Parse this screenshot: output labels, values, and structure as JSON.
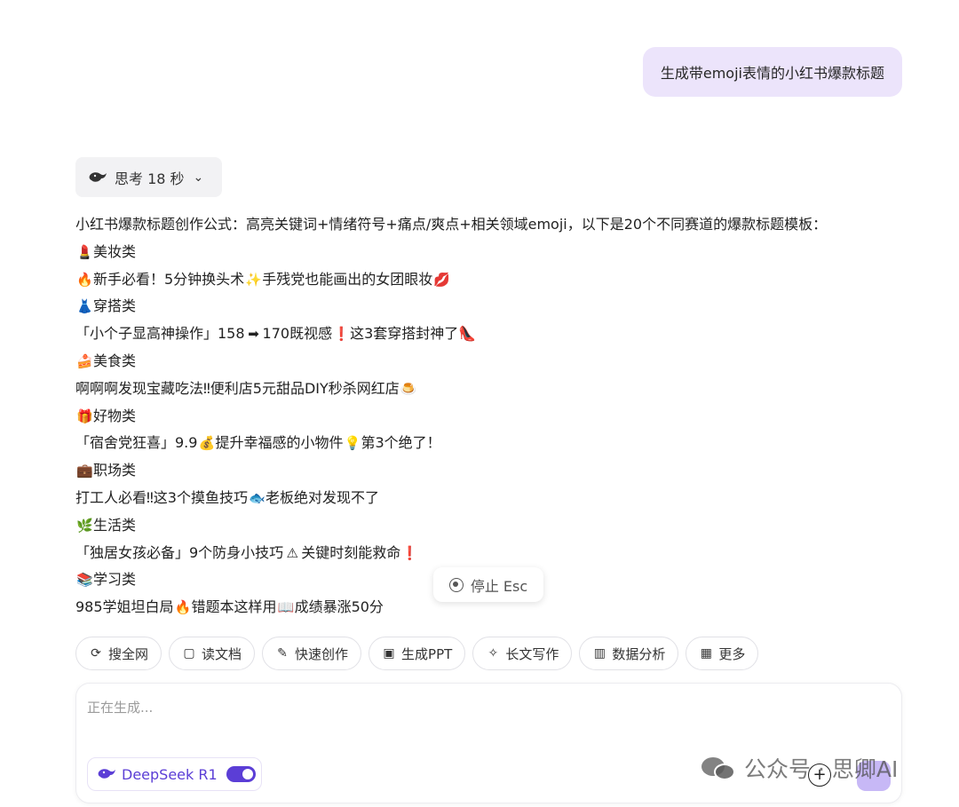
{
  "user_message": "生成带emoji表情的小红书爆款标题",
  "thinking": {
    "label": "思考 18 秒",
    "icon": "deepseek-whale-icon",
    "chevron": "⌄"
  },
  "answer": {
    "intro": "小红书爆款标题创作公式：高亮关键词+情绪符号+痛点/爽点+相关领域emoji，以下是20个不同赛道的爆款标题模板：",
    "sections": [
      {
        "cat_emoji": "💄",
        "category": "美妆类",
        "emoji1": "🔥",
        "part1": "新手必看！5分钟换头术",
        "emoji2": "✨",
        "part2": "手残党也能画出的女团眼妆",
        "emoji3": "💋",
        "part3": ""
      },
      {
        "cat_emoji": "👗",
        "category": "穿搭类",
        "emoji1": "",
        "part1": "「小个子显高神操作」158",
        "emoji2": "➡",
        "part2": "170既视感",
        "emoji3": "❗",
        "part3": "这3套穿搭封神了👠"
      },
      {
        "cat_emoji": "🍰",
        "category": "美食类",
        "emoji1": "",
        "part1": "啊啊啊发现宝藏吃法‼便利店5元甜品DIY秒杀网红店",
        "emoji2": "🍮",
        "part2": "",
        "emoji3": "",
        "part3": ""
      },
      {
        "cat_emoji": "🎁",
        "category": "好物类",
        "emoji1": "",
        "part1": "「宿舍党狂喜」9.9",
        "emoji2": "💰",
        "part2": "提升幸福感的小物件",
        "emoji3": "💡",
        "part3": "第3个绝了！"
      },
      {
        "cat_emoji": "💼",
        "category": "职场类",
        "emoji1": "",
        "part1": "打工人必看‼这3个摸鱼技巧",
        "emoji2": "🐟",
        "part2": "老板绝对发现不了",
        "emoji3": "",
        "part3": ""
      },
      {
        "cat_emoji": "🌿",
        "category": "生活类",
        "emoji1": "",
        "part1": "「独居女孩必备」9个防身小技巧",
        "emoji2": "⚠",
        "part2": "关键时刻能救命",
        "emoji3": "❗",
        "part3": ""
      },
      {
        "cat_emoji": "📚",
        "category": "学习类",
        "emoji1": "",
        "part1": "985学姐坦白局",
        "emoji2": "🔥",
        "part2": "错题本这样用",
        "emoji3": "📖",
        "part3": "成绩暴涨50分"
      }
    ]
  },
  "stop_button": {
    "label": "停止 Esc",
    "icon": "stop-circle-icon"
  },
  "tools": [
    {
      "icon": "search-icon",
      "glyph": "⟳",
      "label": "搜全网"
    },
    {
      "icon": "document-icon",
      "glyph": "▢",
      "label": "读文档"
    },
    {
      "icon": "pen-icon",
      "glyph": "✎",
      "label": "快速创作"
    },
    {
      "icon": "ppt-icon",
      "glyph": "▣",
      "label": "生成PPT"
    },
    {
      "icon": "sparkle-icon",
      "glyph": "✧",
      "label": "长文写作"
    },
    {
      "icon": "chart-icon",
      "glyph": "▥",
      "label": "数据分析"
    },
    {
      "icon": "grid-icon",
      "glyph": "▦",
      "label": "更多"
    }
  ],
  "composer": {
    "placeholder": "正在生成...",
    "model_label": "DeepSeek R1",
    "model_toggle_on": true
  },
  "watermark": {
    "text": "公众号 · 思卿AI"
  },
  "colors": {
    "accent": "#5b3ed6",
    "user_bubble": "#ece4fb"
  }
}
